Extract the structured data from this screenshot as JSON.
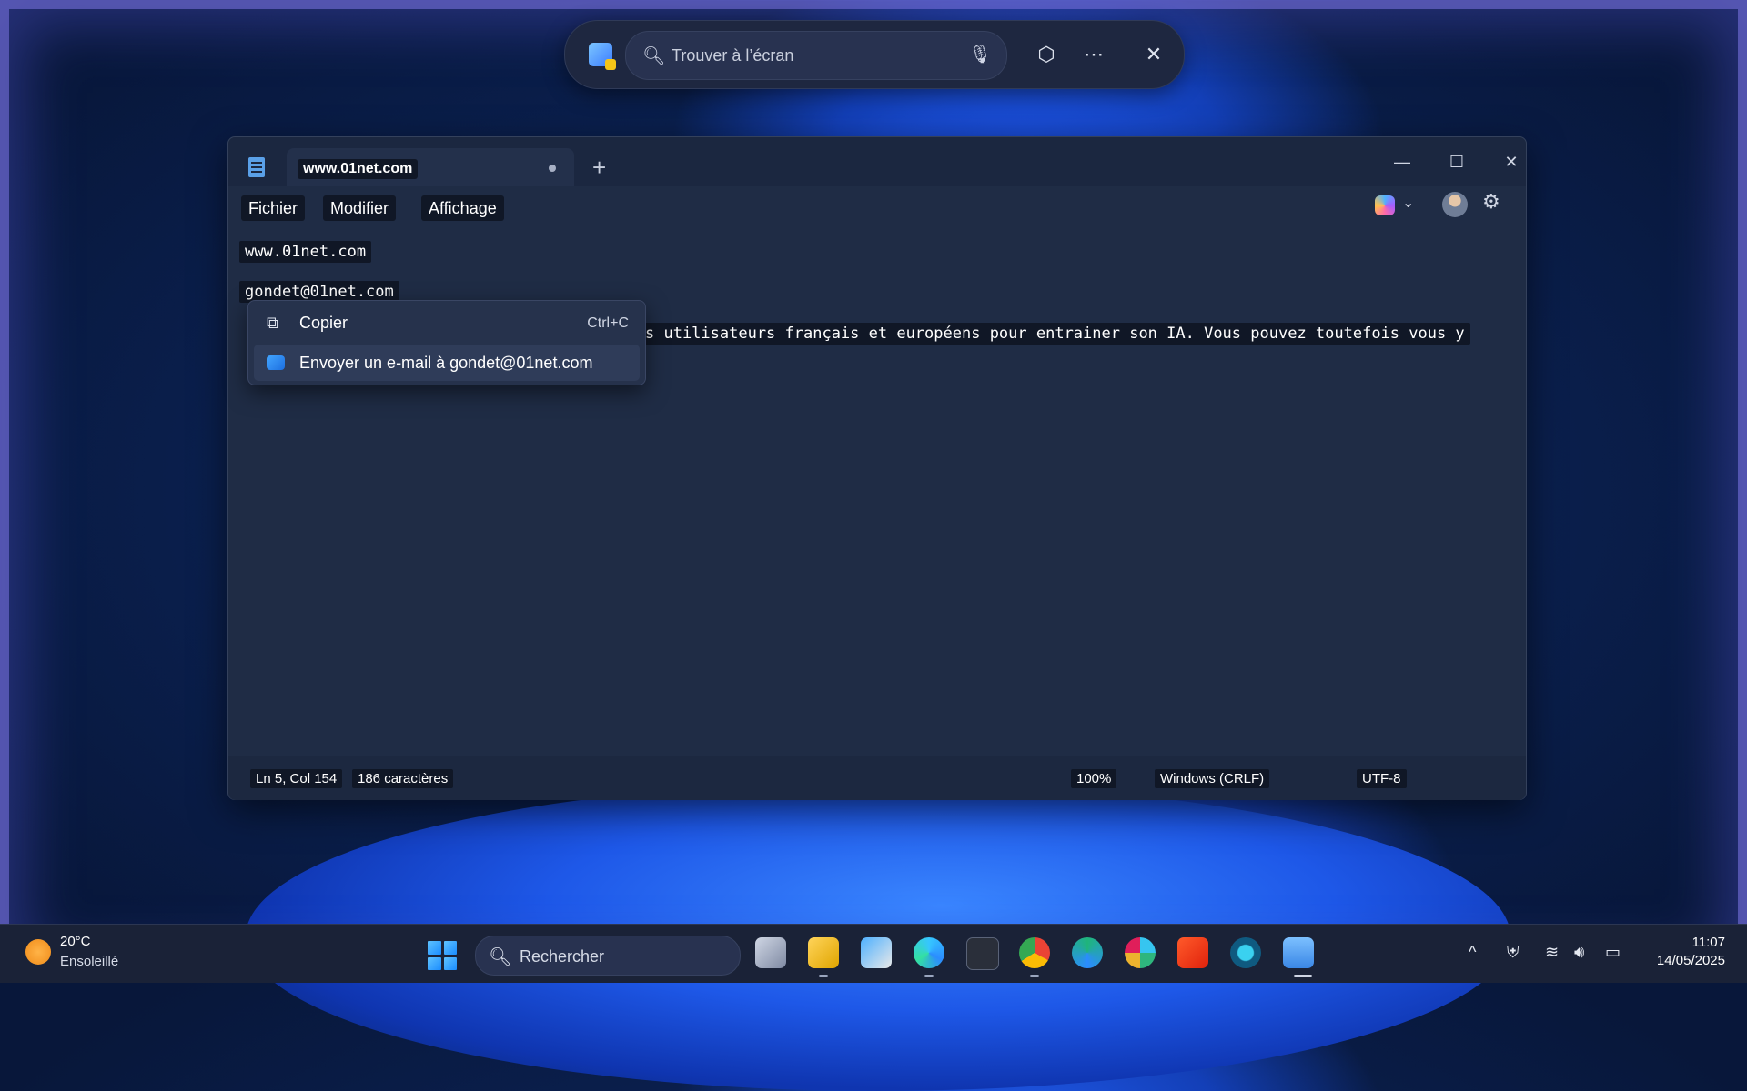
{
  "search_overlay": {
    "placeholder": "Trouver à l’écran"
  },
  "notepad": {
    "tab_title": "www.01net.com",
    "menu": [
      "Fichier",
      "Modifier",
      "Affichage"
    ],
    "lines": [
      "www.01net.com",
      "gondet@01net.com",
      "s utilisateurs français et européens pour entrainer son IA. Vous pouvez toutefois vous y"
    ],
    "status": {
      "position": "Ln 5, Col 154",
      "chars": "186 caractères",
      "zoom": "100%",
      "eol": "Windows (CRLF)",
      "encoding": "UTF-8"
    }
  },
  "context_menu": {
    "items": [
      {
        "label": "Copier",
        "shortcut": "Ctrl+C",
        "icon": "copy-icon"
      },
      {
        "label": "Envoyer un e-mail à gondet@01net.com",
        "shortcut": "",
        "icon": "mail-icon"
      }
    ]
  },
  "taskbar": {
    "weather_temp": "20°C",
    "weather_cond": "Ensoleillé",
    "search_placeholder": "Rechercher",
    "time": "11:07",
    "date": "14/05/2025",
    "apps": [
      "task-view-icon",
      "file-explorer-icon",
      "store-icon",
      "edge-icon",
      "terminal-icon",
      "chrome-icon",
      "edge-can-icon",
      "slack-icon",
      "brave-icon",
      "app-circle-icon",
      "notepad-icon"
    ]
  },
  "colors": {
    "accent": "#1a8cff",
    "window_bg": "#1f2c45",
    "selection_bg": "#101726"
  }
}
